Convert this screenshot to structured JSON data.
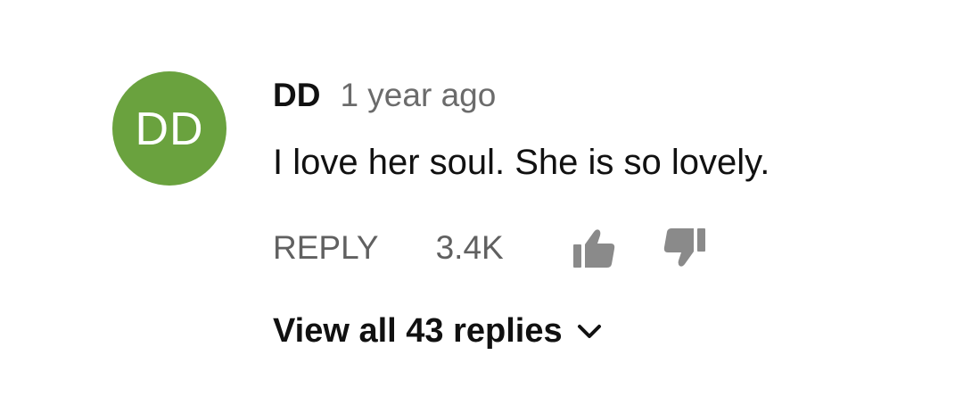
{
  "comment": {
    "avatar": {
      "initials": "DD",
      "color": "#6aa23e"
    },
    "author": "DD",
    "timestamp": "1 year ago",
    "text": "I love her soul. She is so lovely.",
    "actions": {
      "reply_label": "REPLY",
      "like_count": "3.4K",
      "like_icon": "thumbs-up-icon",
      "dislike_icon": "thumbs-down-icon"
    },
    "replies": {
      "label": "View all 43 replies",
      "icon": "chevron-down-icon"
    }
  },
  "colors": {
    "text_primary": "#111111",
    "text_secondary": "#606060",
    "icon_gray": "#8a8a8a"
  }
}
